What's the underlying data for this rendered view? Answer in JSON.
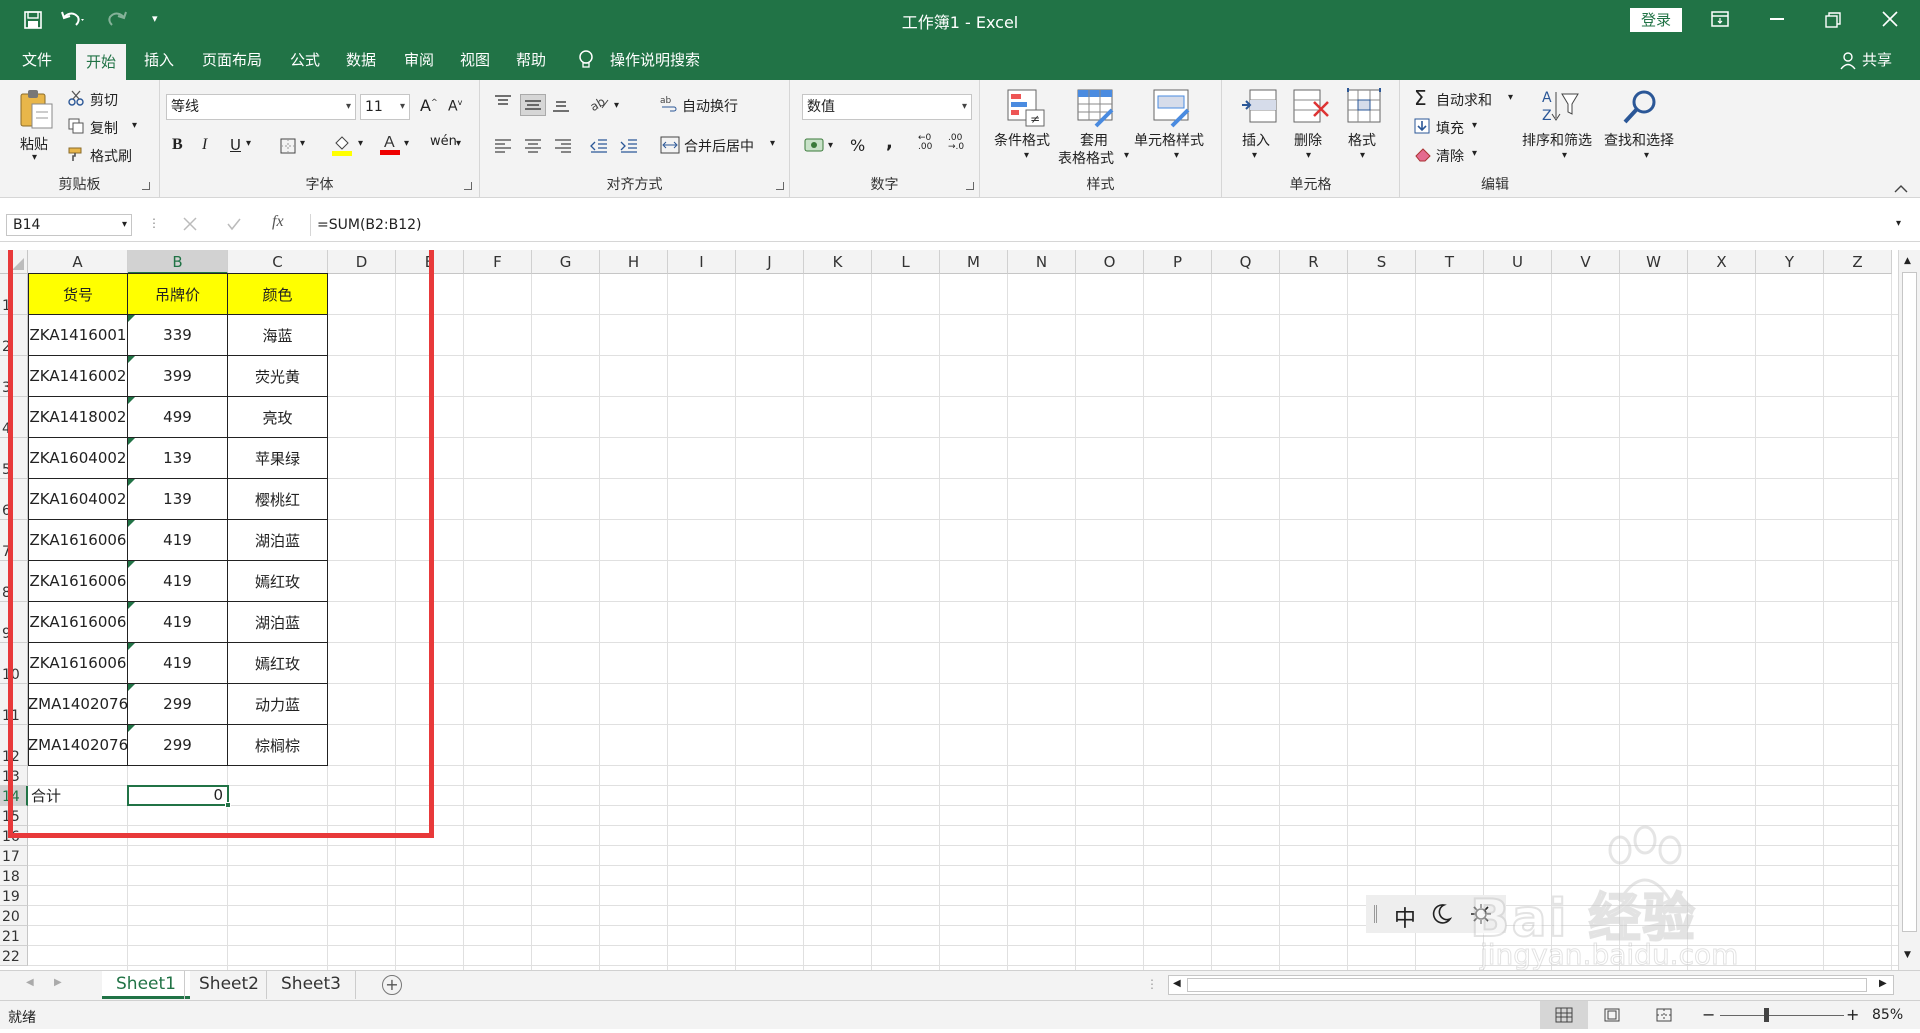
{
  "titlebar": {
    "title": "工作簿1 - Excel",
    "login": "登录"
  },
  "tabs": [
    "文件",
    "开始",
    "插入",
    "页面布局",
    "公式",
    "数据",
    "审阅",
    "视图",
    "帮助"
  ],
  "tell_me": "操作说明搜索",
  "share": "共享",
  "ribbon": {
    "clipboard": {
      "paste": "粘贴",
      "cut": "剪切",
      "copy": "复制",
      "format_painter": "格式刷",
      "label": "剪贴板"
    },
    "font": {
      "name": "等线",
      "size": "11",
      "label": "字体"
    },
    "alignment": {
      "wrap": "自动换行",
      "merge": "合并后居中",
      "label": "对齐方式"
    },
    "number": {
      "format": "数值",
      "label": "数字"
    },
    "styles": {
      "conditional": "条件格式",
      "table_line1": "套用",
      "table_line2": "表格格式",
      "cell_styles": "单元格样式",
      "label": "样式"
    },
    "cells": {
      "insert": "插入",
      "delete": "删除",
      "format": "格式",
      "label": "单元格"
    },
    "editing": {
      "autosum": "自动求和",
      "fill": "填充",
      "clear": "清除",
      "sort": "排序和筛选",
      "find": "查找和选择",
      "label": "编辑"
    }
  },
  "formula_bar": {
    "name_box": "B14",
    "formula": "=SUM(B2:B12)"
  },
  "columns": [
    "A",
    "B",
    "C",
    "D",
    "E",
    "F",
    "G",
    "H",
    "I",
    "J",
    "K",
    "L",
    "M",
    "N",
    "O",
    "P",
    "Q",
    "R",
    "S",
    "T",
    "U",
    "V",
    "W",
    "X",
    "Y",
    "Z"
  ],
  "rows": [
    "1",
    "2",
    "3",
    "4",
    "5",
    "6",
    "7",
    "8",
    "9",
    "10",
    "11",
    "12",
    "13",
    "14",
    "15",
    "16",
    "17",
    "18",
    "19",
    "20",
    "21",
    "22"
  ],
  "table": {
    "headers": [
      "货号",
      "吊牌价",
      "颜色"
    ],
    "rows": [
      [
        "ZKA1416001",
        "339",
        "海蓝"
      ],
      [
        "ZKA1416002",
        "399",
        "荧光黄"
      ],
      [
        "ZKA1418002",
        "499",
        "亮玫"
      ],
      [
        "ZKA1604002",
        "139",
        "苹果绿"
      ],
      [
        "ZKA1604002",
        "139",
        "樱桃红"
      ],
      [
        "ZKA1616006",
        "419",
        "湖泊蓝"
      ],
      [
        "ZKA1616006",
        "419",
        "嫣红玫"
      ],
      [
        "ZKA1616006",
        "419",
        "湖泊蓝"
      ],
      [
        "ZKA1616006",
        "419",
        "嫣红玫"
      ],
      [
        "ZMA1402076",
        "299",
        "动力蓝"
      ],
      [
        "ZMA1402076",
        "299",
        "棕榈棕"
      ]
    ],
    "total_label": "合计",
    "total_value": "0"
  },
  "sheets": [
    "Sheet1",
    "Sheet2",
    "Sheet3"
  ],
  "status": {
    "ready": "就绪",
    "zoom": "85%"
  },
  "ime": {
    "char": "中"
  },
  "watermark": {
    "text": "Bai 经验",
    "url": "jingyan.baidu.com"
  },
  "colors": {
    "excel_green": "#217346",
    "header_fill": "#ffff00",
    "annotation_red": "#e8393a"
  }
}
